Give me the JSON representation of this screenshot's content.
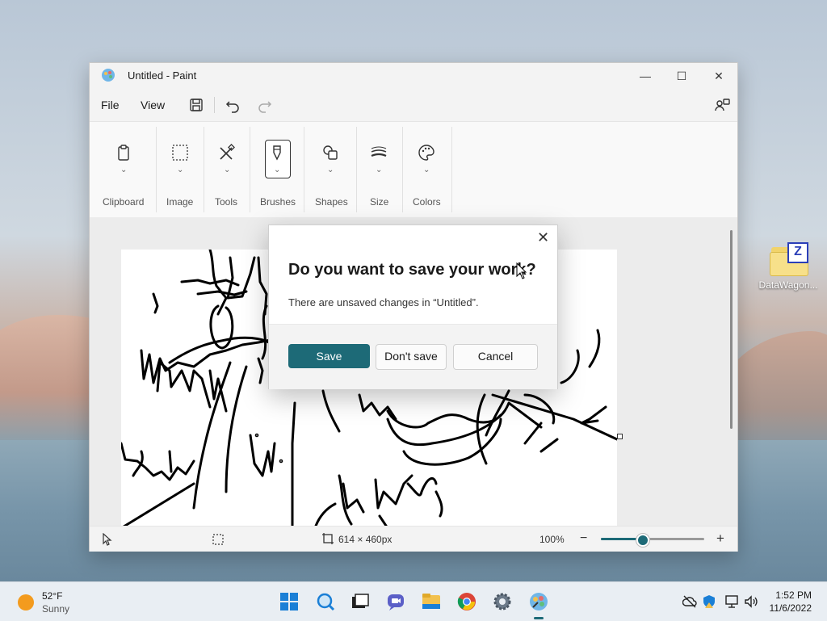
{
  "window": {
    "title": "Untitled - Paint",
    "minimize": "—",
    "maximize": "☐",
    "close": "✕"
  },
  "menu": {
    "file": "File",
    "view": "View"
  },
  "ribbon": {
    "groups": [
      {
        "label": "Clipboard",
        "icon": "clipboard-icon"
      },
      {
        "label": "Image",
        "icon": "selection-icon"
      },
      {
        "label": "Tools",
        "icon": "tools-icon"
      },
      {
        "label": "Brushes",
        "icon": "brush-icon"
      },
      {
        "label": "Shapes",
        "icon": "shapes-icon"
      },
      {
        "label": "Size",
        "icon": "size-icon"
      },
      {
        "label": "Colors",
        "icon": "palette-icon"
      }
    ]
  },
  "dialog": {
    "title": "Do you want to save your work?",
    "message": "There are unsaved changes in “Untitled”.",
    "save": "Save",
    "dont_save": "Don't save",
    "cancel": "Cancel",
    "close": "✕"
  },
  "status": {
    "canvas_size": "614 × 460px",
    "zoom": "100%",
    "zoom_minus": "−",
    "zoom_plus": "+"
  },
  "desktop": {
    "icon_label": "DataWagon..."
  },
  "taskbar": {
    "temperature": "52°F",
    "condition": "Sunny",
    "time": "1:52 PM",
    "date": "11/6/2022"
  },
  "colors": {
    "accent": "#1d6a77"
  }
}
